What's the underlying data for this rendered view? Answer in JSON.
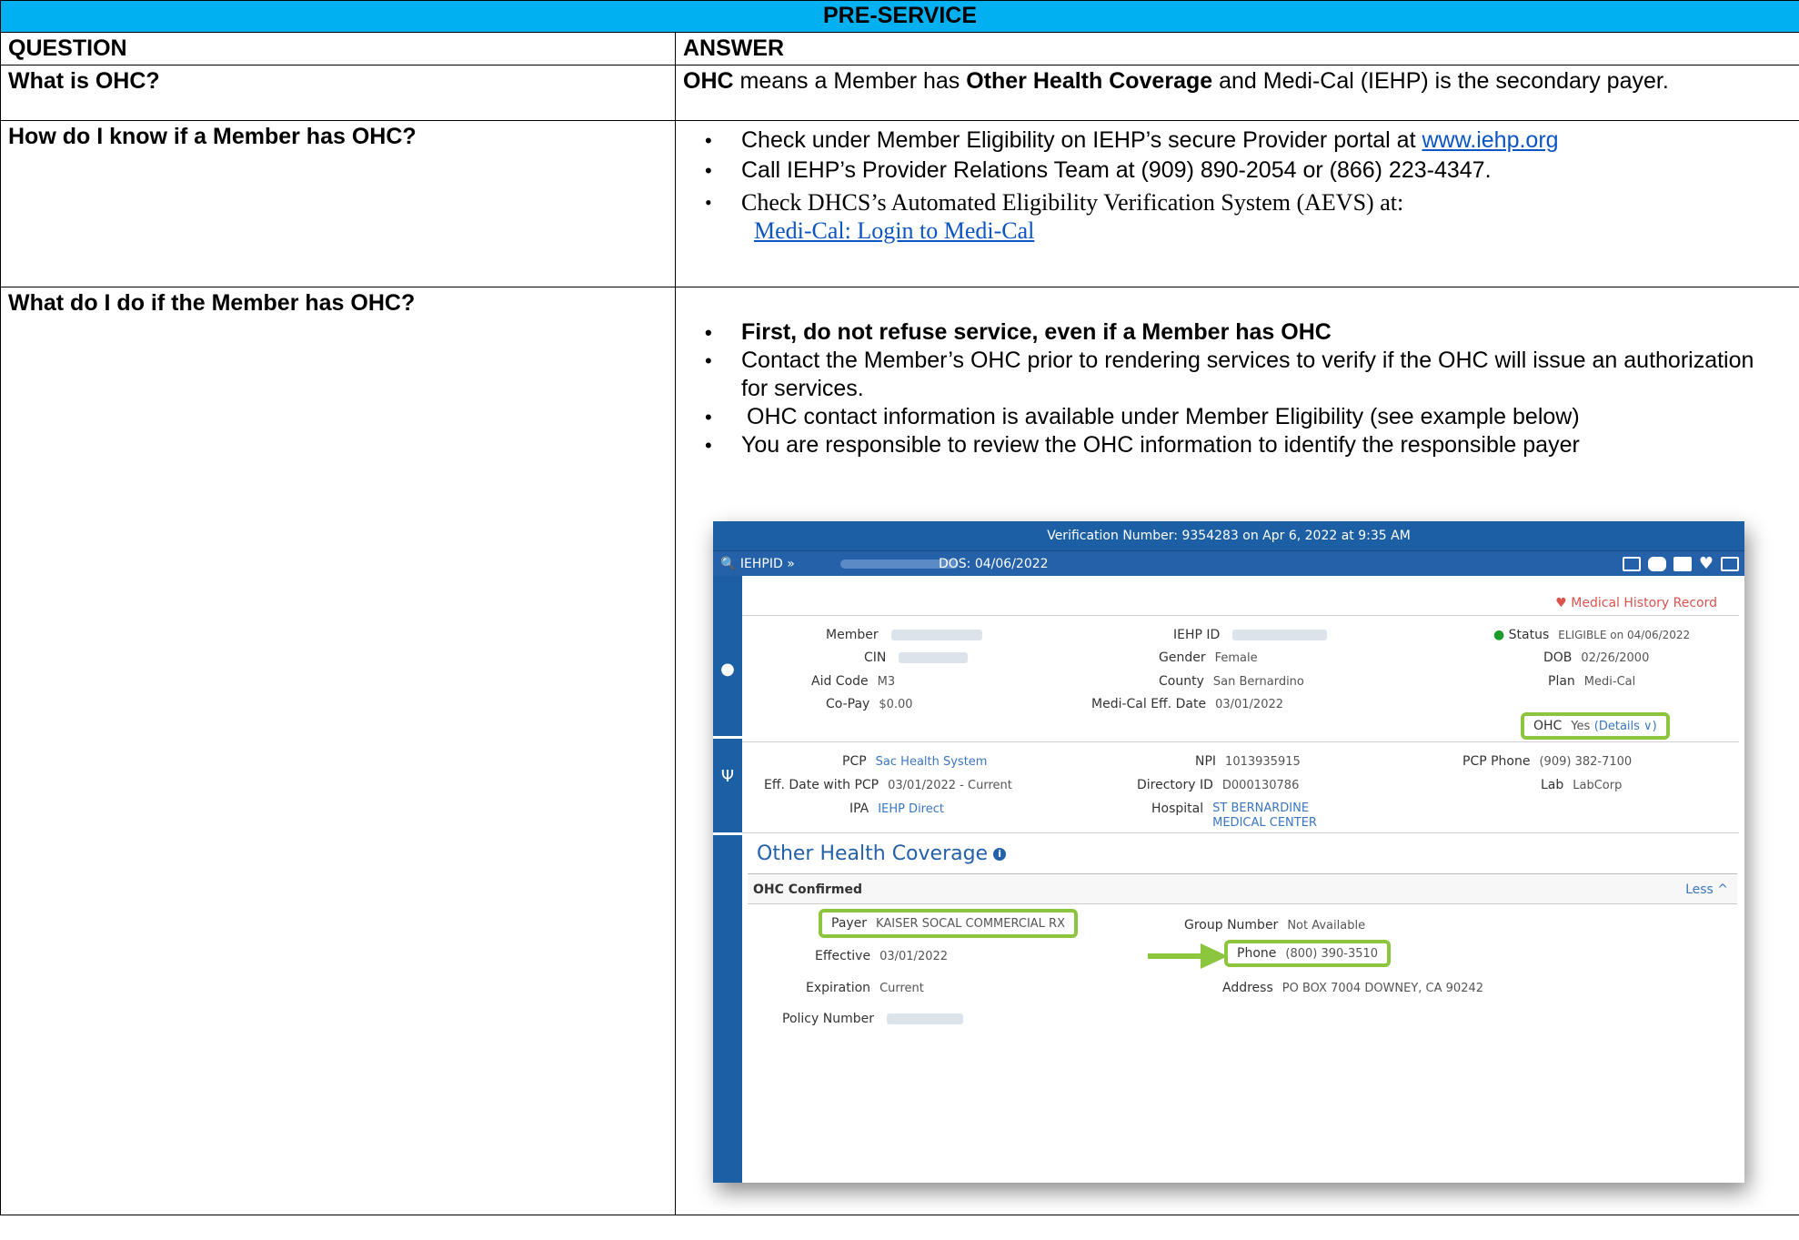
{
  "header": {
    "title": "PRE-SERVICE"
  },
  "columns": {
    "question": "QUESTION",
    "answer": "ANSWER"
  },
  "rows": [
    {
      "question": "What is OHC?",
      "answer": {
        "b1": "OHC",
        "t1": " means a Member has ",
        "b2": "Other Health Coverage",
        "t2": " and Medi-Cal (IEHP) is the secondary payer."
      }
    },
    {
      "question": "How do I know if a Member has OHC?",
      "bullets": [
        {
          "text": "Check under Member Eligibility on IEHP’s secure Provider portal at ",
          "link": "www.iehp.org"
        },
        {
          "text": "Call IEHP’s Provider Relations Team at (909) 890-2054 or (866) 223-4347."
        },
        {
          "text": "Check DHCS’s Automated Eligibility Verification System (AEVS) at:",
          "link": "Medi-Cal: Login to Medi-Cal"
        }
      ]
    },
    {
      "question": "What do I do if the Member has OHC?",
      "bullets": [
        "First, do not refuse service, even if a Member has OHC",
        "Contact the Member’s OHC prior to rendering services to verify if the OHC will issue an authorization for services.",
        "OHC contact information is available under Member Eligibility (see example below)",
        "You are responsible to review the OHC information to identify the responsible payer"
      ]
    }
  ],
  "portal": {
    "verification": "Verification Number: 9354283 on Apr 6, 2022 at 9:35 AM",
    "search_label": "IEHPID »",
    "dos": "DOS: 04/06/2022",
    "medical_history": "Medical History Record",
    "member": {
      "member_label": "Member",
      "cin_label": "CIN",
      "aid_code_label": "Aid Code",
      "aid_code": "M3",
      "copay_label": "Co-Pay",
      "copay": "$0.00",
      "iehp_id_label": "IEHP ID",
      "gender_label": "Gender",
      "gender": "Female",
      "county_label": "County",
      "county": "San Bernardino",
      "medical_eff_label": "Medi-Cal Eff. Date",
      "medical_eff": "03/01/2022",
      "status_label": "Status",
      "status": "ELIGIBLE on 04/06/2022",
      "dob_label": "DOB",
      "dob": "02/26/2000",
      "plan_label": "Plan",
      "plan": "Medi-Cal",
      "ohc_label": "OHC",
      "ohc": "Yes",
      "ohc_details": "(Details ∨)"
    },
    "pcp": {
      "pcp_label": "PCP",
      "pcp": "Sac Health System",
      "eff_label": "Eff. Date with PCP",
      "eff": "03/01/2022 - Current",
      "ipa_label": "IPA",
      "ipa": "IEHP Direct",
      "npi_label": "NPI",
      "npi": "1013935915",
      "directory_label": "Directory ID",
      "directory": "D000130786",
      "hospital_label": "Hospital",
      "hospital_1": "ST BERNARDINE",
      "hospital_2": "MEDICAL CENTER",
      "pcp_phone_label": "PCP Phone",
      "pcp_phone": "(909) 382-7100",
      "lab_label": "Lab",
      "lab": "LabCorp"
    },
    "ohc": {
      "title": "Other Health Coverage",
      "info_icon": "i",
      "confirmed": "OHC Confirmed",
      "less": "Less ^",
      "payer_label": "Payer",
      "payer": "KAISER SOCAL COMMERCIAL RX",
      "effective_label": "Effective",
      "effective": "03/01/2022",
      "expiration_label": "Expiration",
      "expiration": "Current",
      "policy_label": "Policy Number",
      "group_label": "Group Number",
      "group": "Not Available",
      "phone_label": "Phone",
      "phone": "(800) 390-3510",
      "address_label": "Address",
      "address": "PO BOX 7004 DOWNEY, CA 90242"
    },
    "colors": {
      "bar": "#1d5fa5",
      "highlight": "#8cc63f",
      "header": "#00b0f0"
    }
  }
}
